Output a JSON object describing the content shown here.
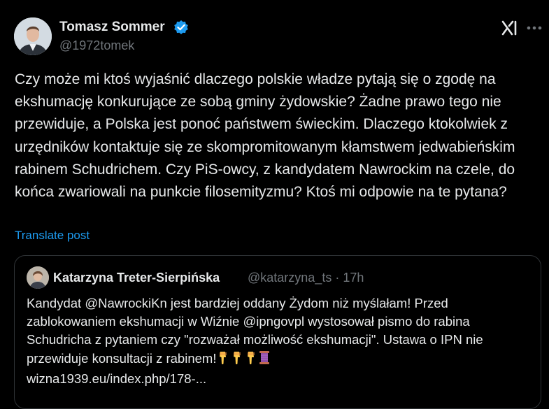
{
  "post": {
    "author_name": "Tomasz Sommer",
    "author_handle": "@1972tomek",
    "text": "Czy może mi ktoś wyjaśnić dlaczego polskie władze pytają się o zgodę na ekshumację konkurujące ze sobą gminy żydowskie? Żadne prawo tego nie przewiduje, a Polska jest ponoć państwem świeckim. Dlaczego ktokolwiek z urzędników kontaktuje się ze skompromitowanym kłamstwem jedwabieńskim rabinem Schudrichem. Czy PiS-owcy, z kandydatem Nawrockim na czele, do końca zwariowali na punkcie filosemityzmu? Ktoś mi odpowie na te pytana?",
    "translate_label": "Translate post"
  },
  "quote": {
    "author_name": "Katarzyna Treter-Sierpińska",
    "author_handle": "@katarzyna_ts",
    "separator": "·",
    "time": "17h",
    "text": "Kandydat @NawrockiKn jest bardziej oddany Żydom niż myślałam! Przed zablokowaniem ekshumacji w Wiźnie @ipngovpl wystosował pismo do rabina Schudricha z pytaniem czy \"rozważał możliwość ekshumacji\". Ustawa o IPN nie przewiduje konsultacji z rabinem!",
    "link": "wizna1939.eu/index.php/178-..."
  },
  "icons": {
    "verified": "verified-badge-icon",
    "grok": "grok-icon",
    "more": "more-options-icon",
    "emoji": [
      "pointing-down-emoji",
      "pointing-down-emoji",
      "pointing-down-emoji",
      "thread-spool-emoji"
    ]
  },
  "colors": {
    "background": "#000000",
    "text": "#e7e9ea",
    "secondary": "#71767b",
    "accent": "#1d9bf0",
    "border": "#2f3336"
  }
}
